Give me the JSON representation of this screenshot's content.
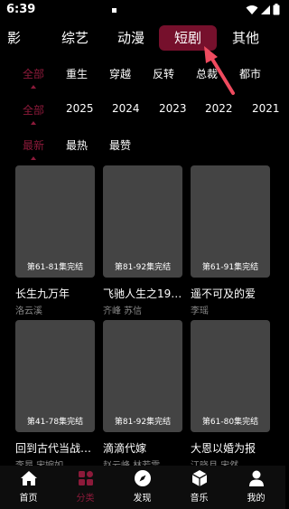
{
  "status": {
    "time": "6:39"
  },
  "top_tabs": [
    {
      "label": "电影",
      "display": "影"
    },
    {
      "label": "综艺"
    },
    {
      "label": "动漫"
    },
    {
      "label": "短剧"
    },
    {
      "label": "其他"
    }
  ],
  "active_top_tab": "短剧",
  "filters": {
    "genre": [
      "全部",
      "重生",
      "穿越",
      "反转",
      "总裁",
      "都市"
    ],
    "year": [
      "全部",
      "2025",
      "2024",
      "2023",
      "2022",
      "2021"
    ],
    "sort": [
      "最新",
      "最热",
      "最赞"
    ]
  },
  "videos": [
    {
      "status": "第61-81集完结",
      "title": "长生九万年",
      "actors": "洛云溪"
    },
    {
      "status": "第81-92集完结",
      "title": "飞驰人生之19…",
      "actors": "齐峰  苏信"
    },
    {
      "status": "第61-91集完结",
      "title": "遥不可及的爱",
      "actors": "李瑶"
    },
    {
      "status": "第41-78集完结",
      "title": "回到古代当战…",
      "actors": "李昂  宋婉如"
    },
    {
      "status": "第81-92集完结",
      "title": "滴滴代嫁",
      "actors": "赵云峰  林若雪"
    },
    {
      "status": "第61-80集完结",
      "title": "大恩以婚为报",
      "actors": "江晓月  宋然"
    }
  ],
  "bottom_nav": [
    {
      "label": "首页",
      "icon": "home-icon"
    },
    {
      "label": "分类",
      "icon": "category-icon"
    },
    {
      "label": "发现",
      "icon": "discover-icon"
    },
    {
      "label": "音乐",
      "icon": "music-icon"
    },
    {
      "label": "我的",
      "icon": "profile-icon"
    }
  ],
  "colors": {
    "accent": "#8c1a3a",
    "active_tab_bg": "#76102c",
    "card_bg": "#444444",
    "annotation": "#ef4b5f"
  }
}
